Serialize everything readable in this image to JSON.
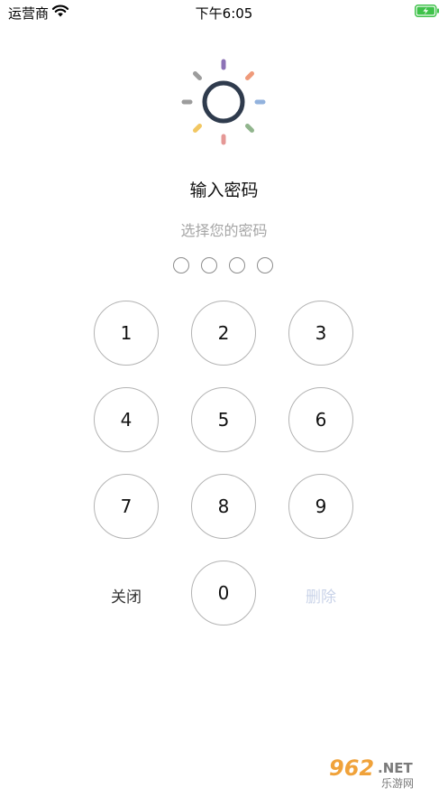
{
  "status": {
    "carrier": "运营商",
    "time": "下午6:05"
  },
  "icons": {
    "wifi": "wifi-icon",
    "battery": "battery-charging-icon",
    "logo": "sun-ring-logo"
  },
  "colors": {
    "logo_ring": "#2f3b4d",
    "rays": [
      "#8c72b6",
      "#ef9a7a",
      "#92b2dd",
      "#91b58d",
      "#e59896",
      "#f2c762",
      "#9c9c9c",
      "#9c9c9c"
    ],
    "battery": "#3fc24a",
    "delete_text": "#c9d3e8",
    "subtitle": "#a6a6a6"
  },
  "passcode": {
    "title": "输入密码",
    "subtitle": "选择您的密码",
    "digits_entered": 0,
    "length": 4
  },
  "keypad": {
    "keys": [
      "1",
      "2",
      "3",
      "4",
      "5",
      "6",
      "7",
      "8",
      "9",
      "0"
    ],
    "close_label": "关闭",
    "delete_label": "删除"
  },
  "watermark": {
    "brand": "962.NET",
    "sub": "乐游网"
  }
}
